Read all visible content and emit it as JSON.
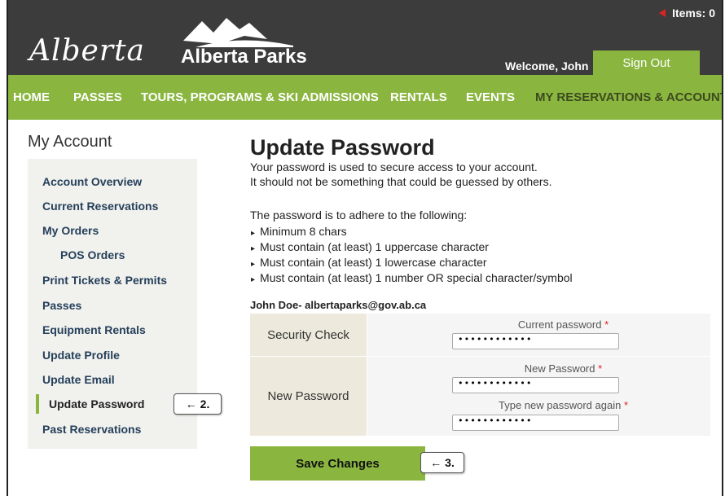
{
  "header": {
    "items_label": "Items: 0",
    "logo_script": "Alberta",
    "logo_text": "Alberta Parks",
    "welcome": "Welcome, John",
    "signout": "Sign Out"
  },
  "nav": [
    "HOME",
    "PASSES",
    "TOURS, PROGRAMS & SKI ADMISSIONS",
    "RENTALS",
    "EVENTS",
    "MY RESERVATIONS & ACCOUNT"
  ],
  "sidebar": {
    "title": "My Account",
    "items": [
      "Account Overview",
      "Current Reservations",
      "My Orders",
      "POS Orders",
      "Print Tickets & Permits",
      "Passes",
      "Equipment Rentals",
      "Update Profile",
      "Update Email",
      "Update Password",
      "Past Reservations"
    ]
  },
  "callouts": {
    "step2": "2.",
    "step3": "3."
  },
  "main": {
    "title": "Update Password",
    "intro1": "Your password is used to secure access to your account.",
    "intro2": "It should not be something that could be guessed by others.",
    "rules_heading": "The password is to adhere to the following:",
    "rules": [
      "Minimum 8 chars",
      "Must contain (at least) 1 uppercase character",
      "Must contain (at least) 1 lowercase character",
      "Must contain (at least) 1 number OR special character/symbol"
    ],
    "owner": "John Doe- albertaparks@gov.ab.ca"
  },
  "form": {
    "security_label": "Security Check",
    "current_label": "Current password",
    "current_value": "••••••••••••",
    "new_section_label": "New Password",
    "new_label": "New Password",
    "new_value": "••••••••••••",
    "confirm_label": "Type new password again",
    "confirm_value": "••••••••••••",
    "required_mark": "*"
  },
  "save_label": "Save Changes",
  "colors": {
    "green": "#8ab640",
    "header": "#3c3c3c",
    "link": "#25405a"
  }
}
